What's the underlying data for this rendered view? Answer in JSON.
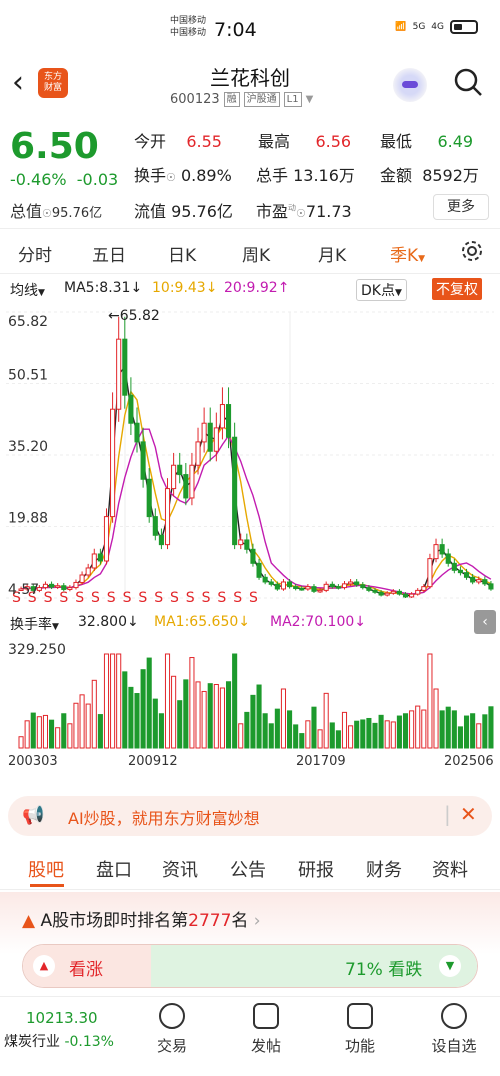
{
  "status": {
    "carrier1": "中国移动",
    "carrier2": "中国移动",
    "time": "7:04",
    "net1": "6",
    "net2": "5G",
    "net3": "4G"
  },
  "header": {
    "back": "‹",
    "logo_line1": "东方",
    "logo_line2": "财富",
    "name": "兰花科创",
    "code": "600123",
    "tag1": "融",
    "tag2": "沪股通",
    "tag3": "L1"
  },
  "quote": {
    "price": "6.50",
    "change_pct": "-0.46%",
    "change": "-0.03",
    "open_label": "今开",
    "open": "6.55",
    "high_label": "最高",
    "high": "6.56",
    "low_label": "最低",
    "low": "6.49",
    "turnover_label": "换手",
    "turnover": "0.89%",
    "volume_label": "总手",
    "volume": "13.16万",
    "amount_label": "金额",
    "amount": "8592万",
    "total_cap_label": "总值",
    "total_cap": "95.76亿",
    "float_cap_label": "流值",
    "float_cap": "95.76亿",
    "pe_label": "市盈",
    "pe_sup": "动",
    "pe": "71.73",
    "more": "更多"
  },
  "periods": [
    "分时",
    "五日",
    "日K",
    "周K",
    "月K",
    "季K"
  ],
  "ma": {
    "label": "均线",
    "ma5": "MA5:8.31↓",
    "ma10": "10:9.43↓",
    "ma20": "20:9.92↑",
    "dk": "DK点",
    "fq": "不复权"
  },
  "chart_data": {
    "type": "candlestick",
    "ylim": [
      4.57,
      65.82
    ],
    "y_ticks": [
      "65.82",
      "50.51",
      "35.20",
      "19.88",
      "4.57"
    ],
    "max_label": "←65.82",
    "min_label": "4.57",
    "x_ticks": [
      "200303",
      "200912",
      "201709",
      "202506"
    ],
    "close": [
      6.5,
      7.0,
      6.2,
      6.8,
      7.5,
      6.9,
      7.2,
      6.4,
      6.8,
      7.9,
      9.5,
      11.0,
      14.0,
      12.5,
      22.0,
      45.0,
      60.0,
      48.0,
      42.0,
      38.0,
      30.0,
      22.0,
      18.0,
      16.0,
      28.0,
      33.0,
      31.0,
      26.0,
      33.0,
      38.0,
      42.0,
      36.0,
      41.0,
      46.0,
      39.0,
      16.0,
      17.0,
      15.0,
      12.0,
      9.0,
      8.0,
      7.5,
      6.5,
      8.0,
      7.0,
      6.6,
      6.5,
      7.0,
      6.0,
      6.2,
      7.5,
      7.0,
      6.8,
      7.6,
      8.0,
      7.4,
      6.8,
      6.2,
      5.8,
      5.2,
      5.6,
      6.0,
      5.4,
      4.8,
      5.4,
      6.2,
      7.0,
      13.0,
      16.0,
      14.0,
      12.0,
      10.5,
      10.0,
      9.0,
      8.0,
      8.5,
      7.6,
      6.5
    ],
    "volume_max": "329.250",
    "turnover_label": "换手率",
    "turnover": "32.800↓",
    "vma1": "MA1:65.650↓",
    "vma2": "MA2:70.100↓"
  },
  "ai_banner": "AI炒股，就用东方财富妙想",
  "bottom_tabs": [
    "股吧",
    "盘口",
    "资讯",
    "公告",
    "研报",
    "财务",
    "资料"
  ],
  "rank": {
    "prefix": "A股市场即时排名第",
    "num": "2777",
    "suffix": "名",
    "bull": "看涨",
    "bear_pct": "71%",
    "bear": "看跌"
  },
  "navbar": {
    "index_value": "10213.30",
    "index_name": "煤炭行业",
    "index_chg": "-0.13%",
    "trade": "交易",
    "post": "发帖",
    "func": "功能",
    "settings": "设自选"
  }
}
